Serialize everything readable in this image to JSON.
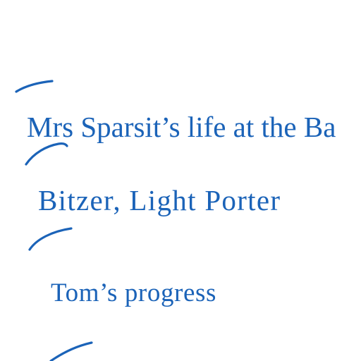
{
  "colors": {
    "background": "#ffffff",
    "ink": "#1b63b8"
  },
  "lines": [
    {
      "text": "Mrs Sparsit’s life at the Ba"
    },
    {
      "text": "Bitzer, Light Porter"
    },
    {
      "text": "Tom’s progress"
    }
  ]
}
